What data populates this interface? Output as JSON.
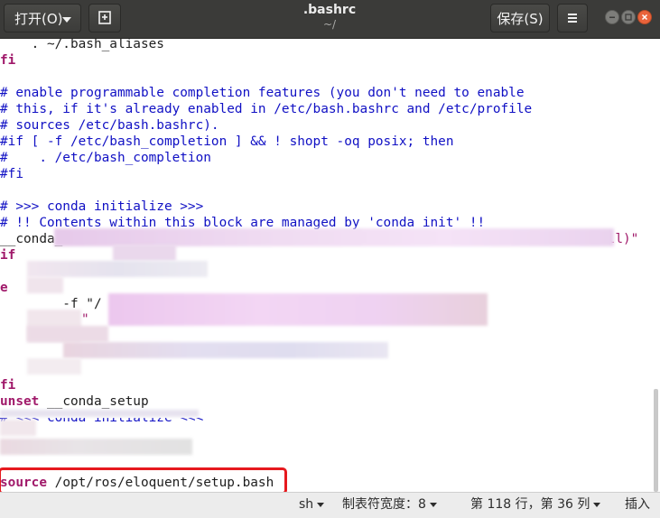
{
  "header": {
    "open_label": "打开(O)",
    "title": ".bashrc",
    "subtitle": "~/",
    "save_label": "保存(S)",
    "menu_icon": "hamburger-menu-icon"
  },
  "editor": {
    "lines": [
      "    . ~/.bash_aliases",
      "fi",
      "",
      "# enable programmable completion features (you don't need to enable",
      "# this, if it's already enabled in /etc/bash.bashrc and /etc/profile",
      "# sources /etc/bash.bashrc).",
      "#if [ -f /etc/bash_completion ] && ! shopt -oq posix; then",
      "#    . /etc/bash_completion",
      "#fi",
      "",
      "# >>> conda initialize >>>",
      "# !! Contents within this block are managed by 'conda init' !!",
      "__conda_set",
      "if",
      "",
      "e",
      "        -f \"/",
      "",
      "",
      "",
      "fi",
      "unset __conda_setup",
      "# <<< conda initialize <<<",
      "",
      "",
      "source /opt/ros/eloquent/setup.bash"
    ],
    "partial_text": {
      "ull_fragment": "ull)\"",
      "quote_fragment": "\""
    },
    "source_line": {
      "keyword": "source",
      "path": "/opt/ros/eloquent/setup.bash"
    }
  },
  "statusbar": {
    "language": "sh",
    "tab_width": "制表符宽度：8",
    "position": "第 118 行，第 36 列",
    "mode": "插入"
  }
}
